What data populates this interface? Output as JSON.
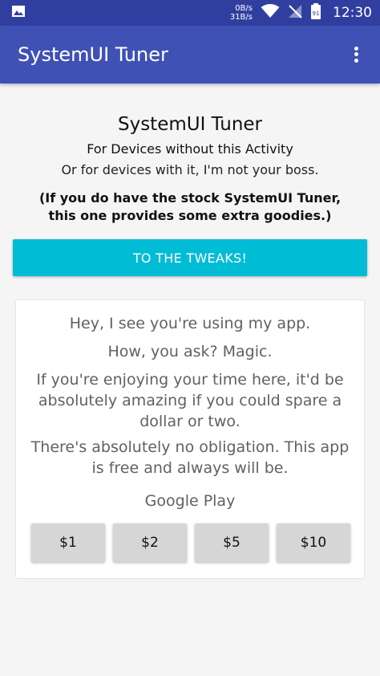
{
  "status_bar": {
    "net_down": "0B/s",
    "net_up": "31B/s",
    "battery": "91",
    "time": "12:30",
    "icons": [
      "image-icon",
      "wifi-icon",
      "no-signal-icon",
      "battery-icon"
    ]
  },
  "app_bar": {
    "title": "SystemUI Tuner",
    "menu_icon": "overflow-menu-icon"
  },
  "intro": {
    "title": "SystemUI Tuner",
    "subtitle1": "For Devices without this Activity",
    "subtitle2": "Or for devices with it, I'm not your boss.",
    "note_line1": "(If you do have the stock SystemUI Tuner,",
    "note_line2": "this one provides some extra goodies.)"
  },
  "tweaks_button": {
    "label": "TO THE TWEAKS!"
  },
  "donate_card": {
    "line1": "Hey, I see you're using my app.",
    "line2": "How, you ask? Magic.",
    "line3": "If you're enjoying your time here, it'd be absolutely amazing if you could spare a dollar or two.",
    "line4": "There's absolutely no obligation. This app is free and always will be.",
    "store_label": "Google Play",
    "amounts": [
      "$1",
      "$2",
      "$5",
      "$10"
    ]
  },
  "colors": {
    "status_bar": "#303f9f",
    "app_bar": "#3f51b5",
    "accent": "#00bcd4",
    "donate_button": "#d6d6d6"
  }
}
